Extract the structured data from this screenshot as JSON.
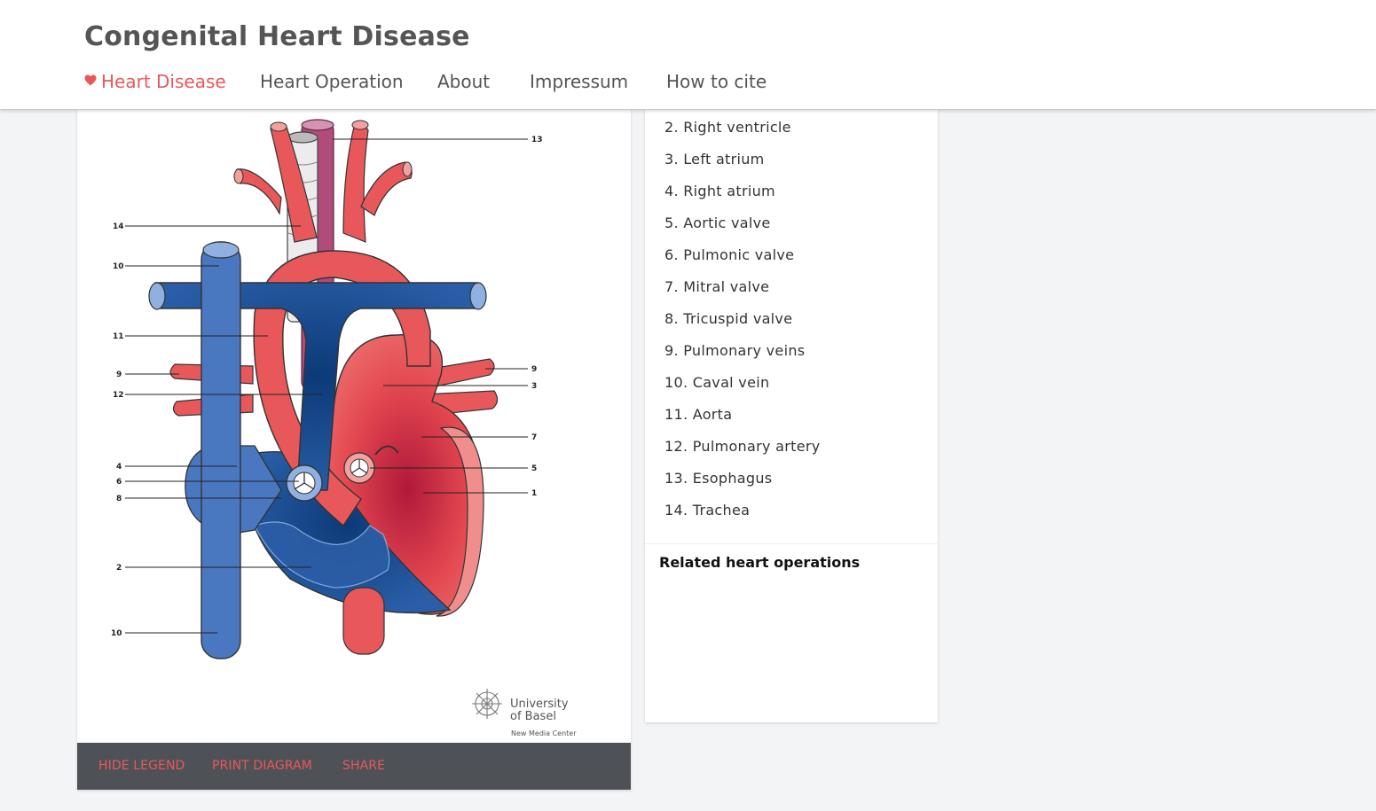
{
  "site": {
    "title": "Congenital Heart Disease"
  },
  "nav": {
    "items": [
      {
        "label": "Heart Disease",
        "active": true,
        "icon": "heart-icon"
      },
      {
        "label": "Heart Operation",
        "active": false
      },
      {
        "label": "About",
        "active": false
      },
      {
        "label": "Impressum",
        "active": false
      },
      {
        "label": "How to cite",
        "active": false
      }
    ]
  },
  "diagram": {
    "labels": [
      "13",
      "14",
      "10",
      "11",
      "9",
      "12",
      "4",
      "6",
      "8",
      "2",
      "10",
      "9",
      "3",
      "7",
      "5",
      "1"
    ],
    "logo": {
      "name_line1": "University",
      "name_line2": "of Basel",
      "sub": "New Media Center"
    }
  },
  "toolbar": {
    "hide_legend": "HIDE LEGEND",
    "print_diagram": "PRINT DIAGRAM",
    "share": "SHARE"
  },
  "legend": {
    "items": [
      "2. Right ventricle",
      "3. Left atrium",
      "4. Right atrium",
      "5. Aortic valve",
      "6. Pulmonic valve",
      "7. Mitral valve",
      "8. Tricuspid valve",
      "9. Pulmonary veins",
      "10. Caval vein",
      "11. Aorta",
      "12. Pulmonary artery",
      "13. Esophagus",
      "14. Trachea"
    ],
    "related_title": "Related heart operations"
  },
  "colors": {
    "accent": "#e8585b",
    "toolbar": "#4e5257",
    "artery": "#e8585b",
    "vein": "#4a78c0"
  }
}
